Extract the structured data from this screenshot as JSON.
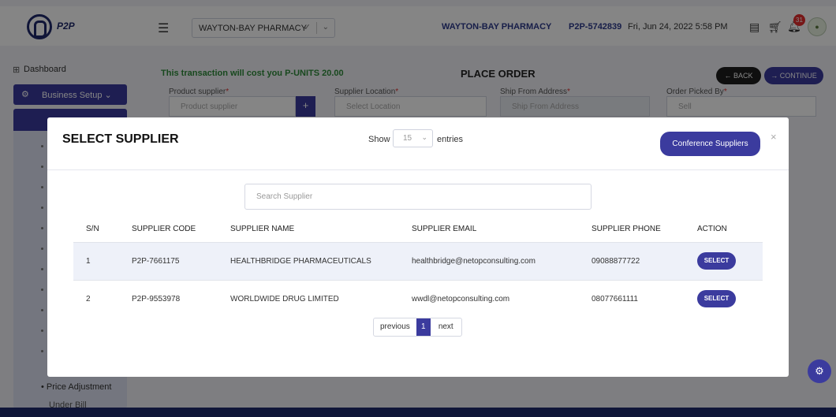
{
  "header": {
    "logo_text": "P2P",
    "store_select": "WAYTON-BAY PHARMACY",
    "store_check": "✓",
    "pharmacy_name": "WAYTON-BAY PHARMACY",
    "pharmacy_id": "P2P-5742839",
    "datetime": "Fri, Jun 24, 2022 5:58 PM",
    "notification_count": "31"
  },
  "sidebar": {
    "dashboard": "Dashboard",
    "business_setup": "Business Setup",
    "price_adjustment": "Price Adjustment",
    "next_item_partial": "Under Bill"
  },
  "order": {
    "cost_note": "This transaction will cost you P-UNITS 20.00",
    "title": "PLACE ORDER",
    "back": "BACK",
    "continue": "CONTINUE",
    "supplier_label": "Product supplier",
    "supplier_placeholder": "Product supplier",
    "location_label": "Supplier Location",
    "location_placeholder": "Select Location",
    "ship_label": "Ship From Address",
    "ship_placeholder": "Ship From Address",
    "picked_label": "Order Picked By",
    "picked_value": "Sell",
    "required_mark": "*"
  },
  "modal": {
    "title": "SELECT SUPPLIER",
    "show": "Show",
    "entries_value": "15",
    "entries": "entries",
    "conference_button": "Conference Suppliers",
    "close": "×",
    "search_placeholder": "Search Supplier",
    "columns": [
      "S/N",
      "SUPPLIER CODE",
      "SUPPLIER NAME",
      "SUPPLIER EMAIL",
      "SUPPLIER PHONE",
      "ACTION"
    ],
    "rows": [
      {
        "sn": "1",
        "code": "P2P-7661175",
        "name": "HEALTHBRIDGE PHARMACEUTICALS",
        "email": "healthbridge@netopconsulting.com",
        "phone": "09088877722",
        "action": "SELECT"
      },
      {
        "sn": "2",
        "code": "P2P-9553978",
        "name": "WORLDWIDE DRUG LIMITED",
        "email": "wwdl@netopconsulting.com",
        "phone": "08077661111",
        "action": "SELECT"
      }
    ],
    "pager": {
      "previous": "previous",
      "current": "1",
      "next": "next"
    }
  },
  "icons": {
    "hamburger": "menu-icon",
    "list": "list-icon",
    "cart": "cart-icon",
    "bell": "bell-icon",
    "settings_fab": "gear-icon"
  },
  "colors": {
    "primary": "#3b3b9e",
    "cost_note": "#2e8b3a",
    "badge": "#e52d2d"
  }
}
